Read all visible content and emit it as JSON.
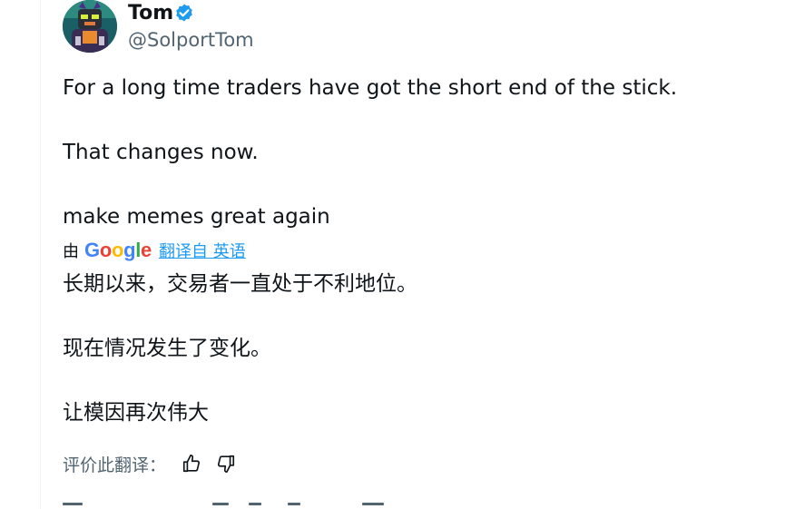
{
  "author": {
    "name": "Tom",
    "handle": "@SolportTom",
    "verified_icon": "verified-badge-icon",
    "verified_color": "#1d9bf0"
  },
  "tweet": {
    "lines": [
      "For a long time traders have got the short end of the stick.",
      "That changes now.",
      "make memes great again"
    ]
  },
  "translation": {
    "by_label": "由",
    "google_logo": "Google",
    "link_label": "翻译自 英语",
    "link_color": "#1d9bf0",
    "lines": [
      "长期以来，交易者一直处于不利地位。",
      "现在情况发生了变化。",
      "让模因再次伟大"
    ]
  },
  "rating": {
    "label": "评价此翻译：",
    "thumbs_up_icon": "thumbs-up-icon",
    "thumbs_down_icon": "thumbs-down-icon"
  },
  "colors": {
    "text_primary": "#0f1419",
    "text_secondary": "#536471",
    "google_blue": "#4285f4",
    "google_red": "#ea4335",
    "google_yellow": "#fbbc05",
    "google_green": "#34a853"
  }
}
